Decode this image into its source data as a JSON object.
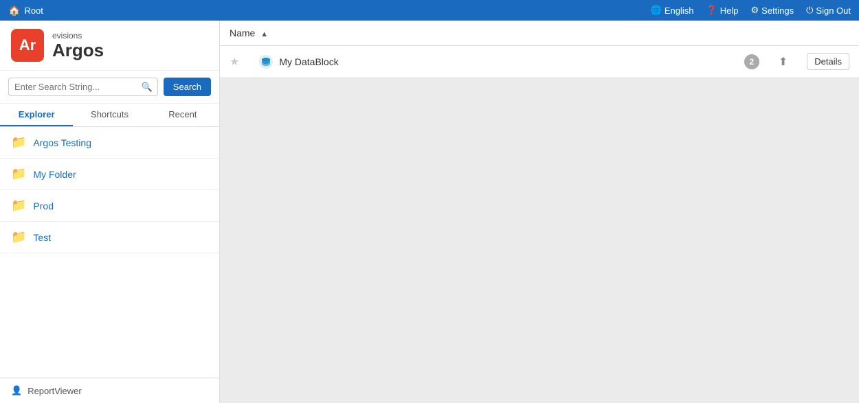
{
  "topbar": {
    "root_label": "Root",
    "english_label": "English",
    "help_label": "Help",
    "settings_label": "Settings",
    "signout_label": "Sign Out"
  },
  "sidebar": {
    "logo": {
      "brand": "evisions",
      "app_name": "Argos",
      "initial": "Ar"
    },
    "search": {
      "placeholder": "Enter Search String...",
      "button_label": "Search"
    },
    "tabs": [
      {
        "id": "explorer",
        "label": "Explorer",
        "active": true
      },
      {
        "id": "shortcuts",
        "label": "Shortcuts",
        "active": false
      },
      {
        "id": "recent",
        "label": "Recent",
        "active": false
      }
    ],
    "folders": [
      {
        "label": "Argos Testing"
      },
      {
        "label": "My Folder"
      },
      {
        "label": "Prod"
      },
      {
        "label": "Test"
      }
    ],
    "bottom_user": "ReportViewer"
  },
  "content": {
    "column_name": "Name",
    "items": [
      {
        "name": "My DataBlock",
        "badge": "2",
        "details_label": "Details"
      }
    ]
  }
}
